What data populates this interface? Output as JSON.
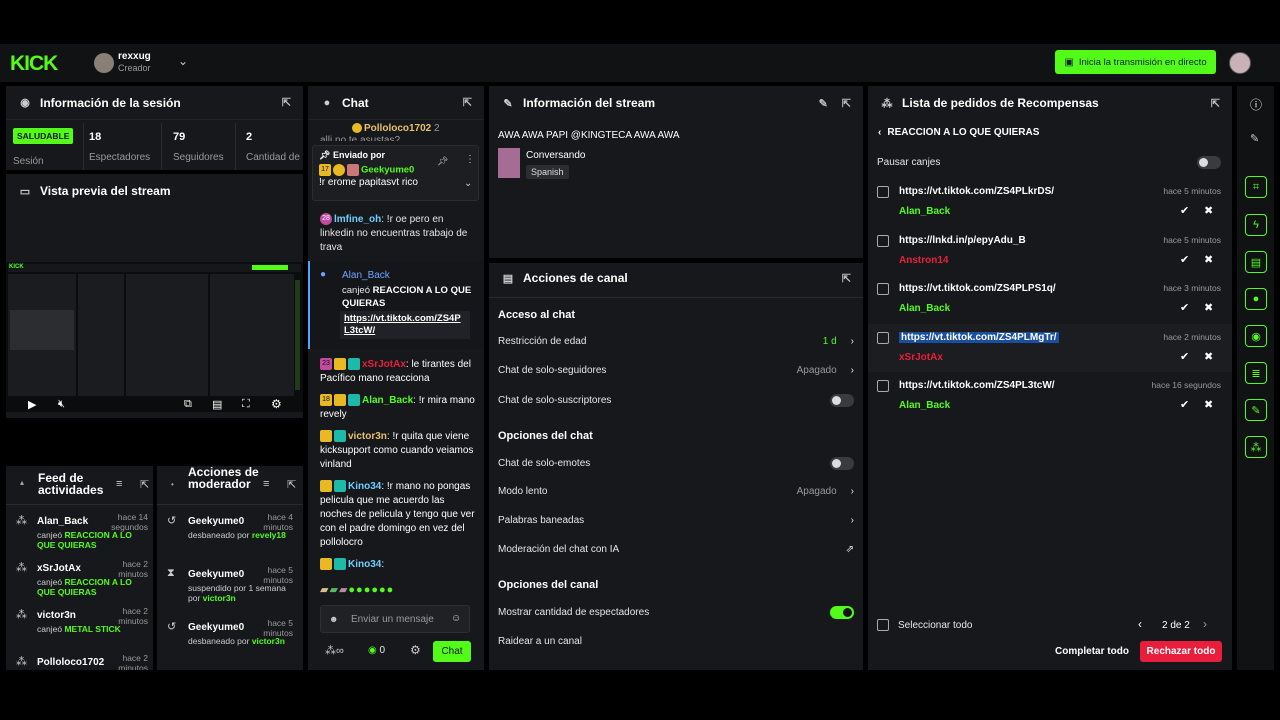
{
  "topbar": {
    "logo": "KICK",
    "user": "rexxug",
    "role": "Creador",
    "live_button": "Inicia la transmisión en directo"
  },
  "session": {
    "title": "Información de la sesión",
    "status": "SALUDABLE",
    "status_label": "Sesión",
    "viewers": "18",
    "viewers_label": "Espectadores",
    "followers": "79",
    "followers_label": "Seguidores",
    "subs": "2",
    "subs_label": "Cantidad de suscripciones"
  },
  "preview": {
    "title": "Vista previa del stream"
  },
  "feed": {
    "title": "Feed de actividades",
    "items": [
      {
        "user": "Alan_Back",
        "time": "hace 14 segundos",
        "action": "canjeó",
        "reward": "REACCION A LO QUE QUIERAS"
      },
      {
        "user": "xSrJotAx",
        "time": "hace 2 minutos",
        "action": "canjeó",
        "reward": "REACCION A LO QUE QUIERAS"
      },
      {
        "user": "victor3n",
        "time": "hace 2 minutos",
        "action": "canjeó",
        "reward": "METAL STICK"
      },
      {
        "user": "Polloloco1702",
        "time": "hace 2 minutos",
        "action": "",
        "reward": ""
      }
    ]
  },
  "modactions": {
    "title": "Acciones de moderador",
    "items": [
      {
        "user": "Geekyume0",
        "time": "hace 4 minutos",
        "desc": "desbaneado por",
        "by": "revely18"
      },
      {
        "user": "Geekyume0",
        "time": "hace 5 minutos",
        "desc": "suspendido por 1 semana por",
        "by": "victor3n"
      },
      {
        "user": "Geekyume0",
        "time": "hace 5 minutos",
        "desc": "desbaneado por",
        "by": "victor3n"
      },
      {
        "user": "Geekyume0",
        "time": "hace 5",
        "desc": "",
        "by": ""
      }
    ]
  },
  "chat": {
    "title": "Chat",
    "top_user": "Polloloco1702",
    "top_count": "2",
    "top_cut": "alli no te asustas?",
    "pinned": {
      "label": "Enviado por",
      "user": "Geekyume0",
      "text": "!r erome papitasvt rico",
      "badge": "17"
    },
    "messages": [
      {
        "badge": "28",
        "user": "lmfine_oh",
        "text": ": !r oe pero en linkedin no encuentras trabajo de trava"
      },
      {
        "badge": "23",
        "user": "xSrJotAx",
        "text": ": le tirantes del Pacífico mano reacciona"
      },
      {
        "badge": "18",
        "user": "Alan_Back",
        "text": ": !r mira mano revely"
      },
      {
        "badge": "",
        "user": "victor3n",
        "text": ": !r quita que viene kicksupport como cuando veiamos vinland"
      },
      {
        "badge": "",
        "user": "Kino34",
        "text": ": !r mano no pongas pelicula que me acuerdo las noches de pelicula y tengo que ver con el padre domingo en vez del pollolocro"
      },
      {
        "badge": "",
        "user": "Kino34",
        "text": ":"
      }
    ],
    "redeem": {
      "user": "Alan_Back",
      "action": "canjeó",
      "reward": "REACCION A LO QUE QUIERAS",
      "link": "https://vt.tiktok.com/ZS4PL3tcW/"
    },
    "placeholder": "Enviar un mensaje",
    "count": "0",
    "send": "Chat"
  },
  "stream": {
    "title": "Información del stream",
    "stream_title": "AWA AWA PAPI @KINGTECA AWA AWA",
    "category": "Conversando",
    "language": "Spanish"
  },
  "channel": {
    "title": "Acciones de canal",
    "section1": "Acceso al chat",
    "age": "Restricción de edad",
    "age_val": "1 d",
    "followers_only": "Chat de solo-seguidores",
    "followers_val": "Apagado",
    "subs_only": "Chat de solo-suscriptores",
    "section2": "Opciones del chat",
    "emotes_only": "Chat de solo-emotes",
    "slow": "Modo lento",
    "slow_val": "Apagado",
    "banned_words": "Palabras baneadas",
    "ai_mod": "Moderación del chat con IA",
    "section3": "Opciones del canal",
    "show_viewers": "Mostrar cantidad de espectadores",
    "raid": "Raidear a un canal"
  },
  "rewards": {
    "title": "Lista de pedidos de Recompensas",
    "back": "REACCION A LO QUE QUIERAS",
    "pause": "Pausar canjes",
    "items": [
      {
        "link": "https://vt.tiktok.com/ZS4PLkrDS/",
        "time": "hace 5 minutos",
        "user": "Alan_Back",
        "color": "#53fc18"
      },
      {
        "link": "https://lnkd.in/p/epyAdu_B",
        "time": "hace 5 minutos",
        "user": "Anstron14",
        "color": "#e91e3c"
      },
      {
        "link": "https://vt.tiktok.com/ZS4PLPS1q/",
        "time": "hace 3 minutos",
        "user": "Alan_Back",
        "color": "#53fc18"
      },
      {
        "link": "https://vt.tiktok.com/ZS4PLMgTr/",
        "time": "hace 2 minutos",
        "user": "xSrJotAx",
        "color": "#e91e3c"
      },
      {
        "link": "https://vt.tiktok.com/ZS4PL3tcW/",
        "time": "hace 16 segundos",
        "user": "Alan_Back",
        "color": "#53fc18"
      }
    ],
    "select_all": "Seleccionar todo",
    "page": "2 de 2",
    "complete": "Completar todo",
    "reject": "Rechazar todo"
  }
}
